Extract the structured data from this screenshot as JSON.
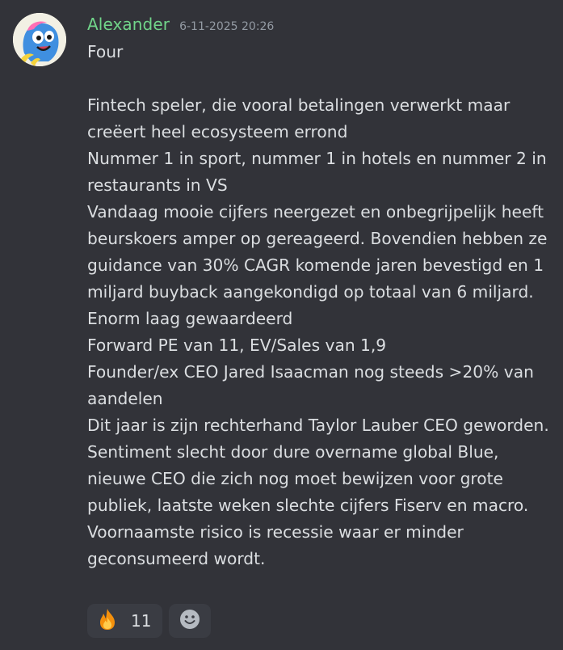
{
  "message": {
    "author": "Alexander",
    "timestamp": "6-11-2025 20:26",
    "lines": [
      "Four",
      "",
      "Fintech speler, die vooral betalingen verwerkt maar creëert heel ecosysteem errond",
      "Nummer 1 in sport, nummer 1 in hotels en nummer 2 in restaurants in VS",
      "Vandaag mooie cijfers neergezet en onbegrijpelijk heeft beurskoers amper op gereageerd. Bovendien hebben ze guidance van 30% CAGR komende jaren bevestigd en 1 miljard buyback aangekondigd op totaal van 6 miljard.",
      "Enorm laag gewaardeerd",
      "Forward PE van 11, EV/Sales van 1,9",
      "Founder/ex CEO Jared Isaacman nog steeds >20% van aandelen",
      "Dit jaar is zijn rechterhand Taylor Lauber CEO geworden.",
      "Sentiment slecht door dure overname global Blue, nieuwe CEO die zich nog moet bewijzen voor grote publiek, laatste weken slechte cijfers Fiserv en macro.",
      "Voornaamste risico is recessie waar er minder geconsumeerd wordt."
    ],
    "reactions": [
      {
        "emoji": "fire-icon",
        "count": "11"
      }
    ],
    "add_reaction_icon": "smiley-icon"
  },
  "colors": {
    "background": "#323339",
    "username": "#71d58a",
    "text": "#dbdee1",
    "timestamp": "#949ba4",
    "reaction_bg": "#3a3c43"
  }
}
